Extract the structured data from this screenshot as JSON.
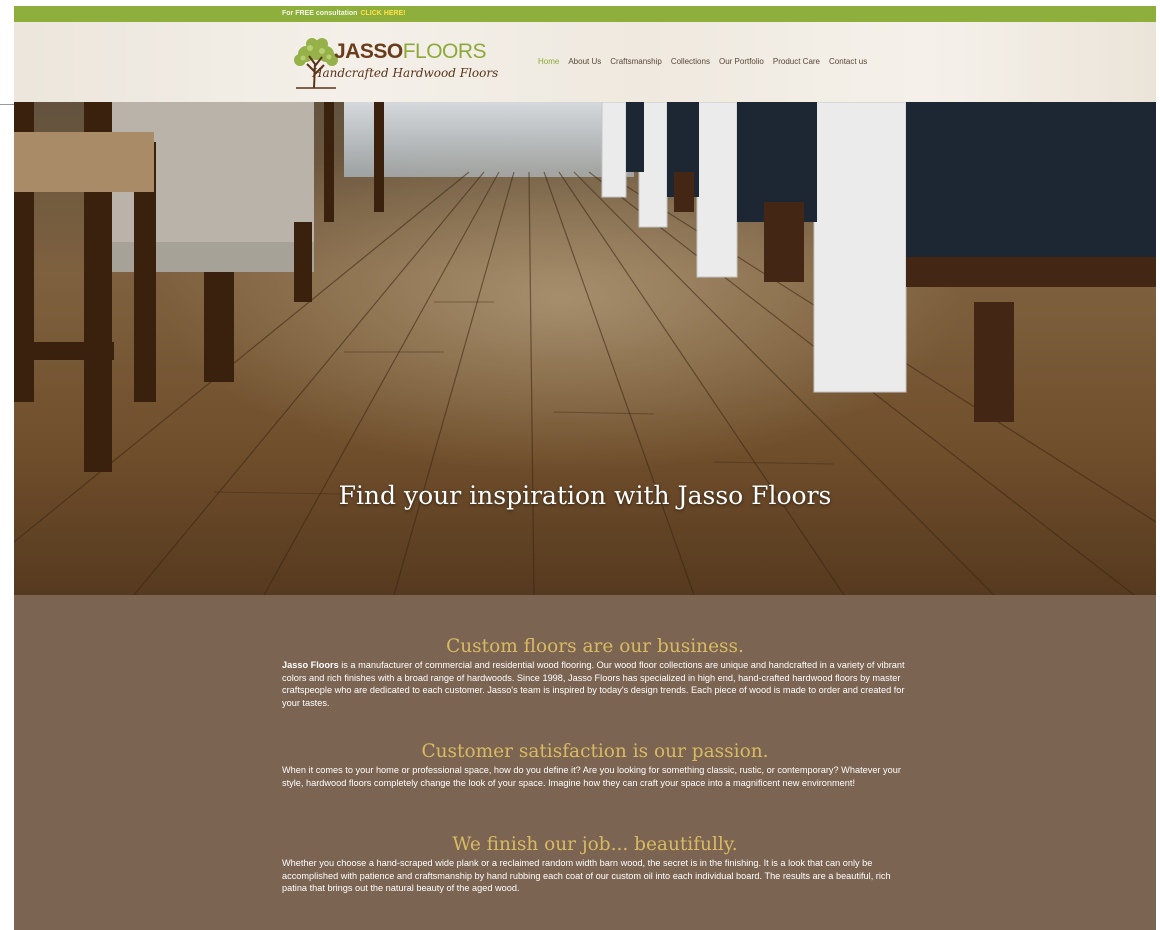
{
  "topbar": {
    "message": "For FREE consultation",
    "cta": "CLICK HERE!"
  },
  "logo": {
    "brand_part1": "JASSO",
    "brand_part2": "FLOORS",
    "tagline": "Handcrafted Hardwood Floors",
    "icon": "tree-icon"
  },
  "nav": {
    "items": [
      "Home",
      "About Us",
      "Craftsmanship",
      "Collections",
      "Our Portfolio",
      "Product Care",
      "Contact us"
    ],
    "active": "Home"
  },
  "hero": {
    "title": "Find your inspiration with Jasso Floors"
  },
  "sections": [
    {
      "heading": "Custom floors are our business.",
      "lead_bold": "Jasso Floors",
      "body": " is a manufacturer of commercial and residential wood flooring. Our wood floor collections are unique and handcrafted in a variety of vibrant colors and rich finishes with a broad range of hardwoods. Since 1998, Jasso Floors has specialized in high end, hand-crafted hardwood floors by master craftspeople who are dedicated to each customer. Jasso's team is inspired by today's design trends. Each piece of wood is made to order and created for your tastes."
    },
    {
      "heading": "Customer satisfaction is our passion.",
      "body": "When it comes to your home or professional space, how do you define it? Are you looking for something classic, rustic, or contemporary? Whatever your style, hardwood floors completely change the look of your space. Imagine how they can craft your space into a magnificent new environment!"
    },
    {
      "heading": "We finish our job... beautifully.",
      "body": "Whether you choose a hand-scraped wide plank or a reclaimed random width barn wood, the secret is in the finishing. It is a look that can only be accomplished with patience and craftsmanship by hand rubbing each coat of our custom oil into each individual board. The results are a beautiful, rich patina that brings out the natural beauty of the aged wood."
    }
  ],
  "colors": {
    "topbar": "#8faf3c",
    "accent_green": "#8caa3a",
    "brand_brown": "#6a3c1c",
    "content_bg": "#7b6452",
    "heading_gold": "#d9ba63"
  }
}
